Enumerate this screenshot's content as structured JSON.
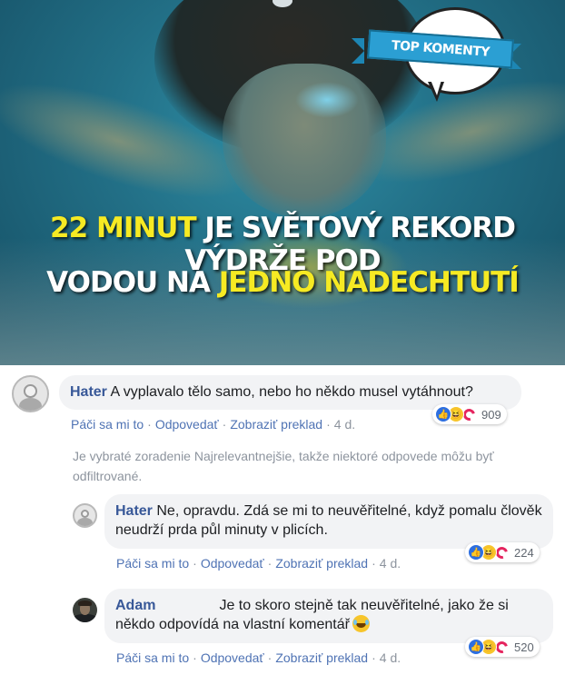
{
  "hero": {
    "headline_line1_hl": "22 MINUT",
    "headline_line1_rest": " JE SVĚTOVÝ REKORD VÝDRŽE POD",
    "headline_line2_pre": "VODOU NA ",
    "headline_line2_hl": "JEDNO NADECHTUTÍ",
    "badge_label": "TOP KOMENTY"
  },
  "comments": [
    {
      "author": "Hater",
      "text": "A vyplavalo tělo samo, nebo ho někdo musel vytáhnout?",
      "actions": {
        "like": "Páči sa mi to",
        "reply": "Odpovedať",
        "translate": "Zobraziť preklad",
        "time": "4 d."
      },
      "reactions_count": "909",
      "reactions": [
        "like-icon",
        "haha-icon",
        "angry-icon"
      ]
    },
    {
      "author": "Hater",
      "text": "Ne, opravdu. Zdá se mi to neuvěřitelné, když pomalu člověk neudrží prda půl minuty v plicích.",
      "actions": {
        "like": "Páči sa mi to",
        "reply": "Odpovedať",
        "translate": "Zobraziť preklad",
        "time": "4 d."
      },
      "reactions_count": "224",
      "reactions": [
        "like-icon",
        "haha-icon",
        "angry-icon"
      ]
    },
    {
      "author": "Adam",
      "text": "Je to skoro stejně tak neuvěřitelné, jako že si někdo odpovídá na vlastní komentář",
      "actions": {
        "like": "Páči sa mi to",
        "reply": "Odpovedať",
        "translate": "Zobraziť preklad",
        "time": "4 d."
      },
      "reactions_count": "520",
      "reactions": [
        "like-icon",
        "haha-icon",
        "angry-icon"
      ]
    }
  ],
  "filter_notice": "Je vybraté zoradenie Najrelevantnejšie, takže niektoré odpovede môžu byť odfiltrované.",
  "separator": "·",
  "colors": {
    "author": "#385898",
    "link": "#4f73b4",
    "muted": "#8d949e",
    "bubble": "#f2f3f5",
    "highlight": "#f6ea23",
    "ribbon": "#2b9fd3"
  }
}
